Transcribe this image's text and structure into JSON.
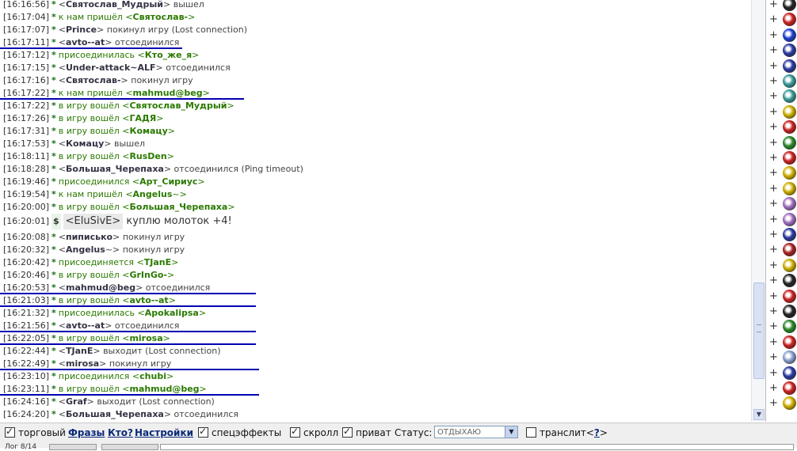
{
  "chat": {
    "lines": [
      {
        "ts": "[16:16:56]",
        "marker": "*",
        "segments": [
          {
            "t": "<",
            "c": "gray"
          },
          {
            "t": "Святослав_Мудрый",
            "c": "nick dark"
          },
          {
            "t": ">",
            "c": "gray"
          },
          {
            "t": " вышел",
            "c": "gray"
          }
        ]
      },
      {
        "ts": "[16:17:04]",
        "marker": "*",
        "segments": [
          {
            "t": "к нам пришёл <",
            "c": "green"
          },
          {
            "t": "Святослав-",
            "c": "nick green"
          },
          {
            "t": ">",
            "c": "green"
          }
        ]
      },
      {
        "ts": "[16:17:07]",
        "marker": "*",
        "segments": [
          {
            "t": "<",
            "c": "gray"
          },
          {
            "t": "Prince",
            "c": "nick dark"
          },
          {
            "t": "> покинул игру (Lost connection)",
            "c": "gray"
          }
        ]
      },
      {
        "ts": "[16:17:11]",
        "marker": "*",
        "segments": [
          {
            "t": "<",
            "c": "gray"
          },
          {
            "t": "avto--at",
            "c": "nick dark"
          },
          {
            "t": "> отсоединился",
            "c": "gray"
          }
        ],
        "ul": 230
      },
      {
        "ts": "[16:17:12]",
        "marker": "*",
        "segments": [
          {
            "t": "присоединилась <",
            "c": "green"
          },
          {
            "t": "Кто_же_я",
            "c": "nick green"
          },
          {
            "t": ">",
            "c": "green"
          }
        ]
      },
      {
        "ts": "[16:17:15]",
        "marker": "*",
        "segments": [
          {
            "t": "<",
            "c": "gray"
          },
          {
            "t": "Under-attack~ALF",
            "c": "nick dark"
          },
          {
            "t": "> отсоединился",
            "c": "gray"
          }
        ]
      },
      {
        "ts": "[16:17:16]",
        "marker": "*",
        "segments": [
          {
            "t": "<",
            "c": "gray"
          },
          {
            "t": "Святослав-",
            "c": "nick dark"
          },
          {
            "t": "> покинул игру",
            "c": "gray"
          }
        ]
      },
      {
        "ts": "[16:17:22]",
        "marker": "*",
        "segments": [
          {
            "t": "к нам пришёл <",
            "c": "green"
          },
          {
            "t": "mahmud@beg",
            "c": "nick green"
          },
          {
            "t": ">",
            "c": "green"
          }
        ],
        "ul": 308
      },
      {
        "ts": "[16:17:22]",
        "marker": "*",
        "segments": [
          {
            "t": "в игру вошёл <",
            "c": "green"
          },
          {
            "t": "Святослав_Мудрый",
            "c": "nick green"
          },
          {
            "t": ">",
            "c": "green"
          }
        ]
      },
      {
        "ts": "[16:17:26]",
        "marker": "*",
        "segments": [
          {
            "t": "в игру вошёл <",
            "c": "green"
          },
          {
            "t": "ГАДЯ",
            "c": "nick green"
          },
          {
            "t": ">",
            "c": "green"
          }
        ]
      },
      {
        "ts": "[16:17:31]",
        "marker": "*",
        "segments": [
          {
            "t": "в игру вошёл <",
            "c": "green"
          },
          {
            "t": "Комацу",
            "c": "nick green"
          },
          {
            "t": ">",
            "c": "green"
          }
        ]
      },
      {
        "ts": "[16:17:53]",
        "marker": "*",
        "segments": [
          {
            "t": "<",
            "c": "gray"
          },
          {
            "t": "Комацу",
            "c": "nick dark"
          },
          {
            "t": "> вышел",
            "c": "gray"
          }
        ]
      },
      {
        "ts": "[16:18:11]",
        "marker": "*",
        "segments": [
          {
            "t": "в игру вошёл <",
            "c": "green"
          },
          {
            "t": "RusDen",
            "c": "nick green"
          },
          {
            "t": ">",
            "c": "green"
          }
        ]
      },
      {
        "ts": "[16:18:28]",
        "marker": "*",
        "segments": [
          {
            "t": "<",
            "c": "gray"
          },
          {
            "t": "Большая_Черепаха",
            "c": "nick dark"
          },
          {
            "t": "> отсоединился (Ping timeout)",
            "c": "gray"
          }
        ]
      },
      {
        "ts": "[16:19:46]",
        "marker": "*",
        "segments": [
          {
            "t": "присоединился <",
            "c": "green"
          },
          {
            "t": "Арт_Сириус",
            "c": "nick green"
          },
          {
            "t": ">",
            "c": "green"
          }
        ]
      },
      {
        "ts": "[16:19:54]",
        "marker": "*",
        "segments": [
          {
            "t": "к нам пришёл <",
            "c": "green"
          },
          {
            "t": "Angelus",
            "c": "nick green"
          },
          {
            "t": "~>",
            "c": "green"
          }
        ]
      },
      {
        "ts": "[16:20:00]",
        "marker": "*",
        "segments": [
          {
            "t": "в игру вошёл <",
            "c": "green"
          },
          {
            "t": "Большая_Черепаха",
            "c": "nick green"
          },
          {
            "t": ">",
            "c": "green"
          }
        ]
      },
      {
        "ts": "[16:20:01]",
        "marker": "$",
        "big": true,
        "segments": [
          {
            "t": "<EluSivE>",
            "c": "bigbox"
          },
          {
            "t": " куплю молоток +4!",
            "c": "big"
          }
        ]
      },
      {
        "ts": "[16:20:08]",
        "marker": "*",
        "segments": [
          {
            "t": "<",
            "c": "gray"
          },
          {
            "t": "пиписько",
            "c": "nick dark"
          },
          {
            "t": "> покинул игру",
            "c": "gray"
          }
        ]
      },
      {
        "ts": "[16:20:32]",
        "marker": "*",
        "segments": [
          {
            "t": "<",
            "c": "gray"
          },
          {
            "t": "Angelus",
            "c": "nick dark"
          },
          {
            "t": "~> покинул игру",
            "c": "gray"
          }
        ]
      },
      {
        "ts": "[16:20:42]",
        "marker": "*",
        "segments": [
          {
            "t": "присоединяется <",
            "c": "green"
          },
          {
            "t": "TJanE",
            "c": "nick green"
          },
          {
            "t": ">",
            "c": "green"
          }
        ]
      },
      {
        "ts": "[16:20:46]",
        "marker": "*",
        "segments": [
          {
            "t": "в игру вошёл <",
            "c": "green"
          },
          {
            "t": "GrInGo-",
            "c": "nick green"
          },
          {
            "t": ">",
            "c": "green"
          }
        ]
      },
      {
        "ts": "[16:20:53]",
        "marker": "*",
        "segments": [
          {
            "t": "<",
            "c": "gray"
          },
          {
            "t": "mahmud@beg",
            "c": "nick dark"
          },
          {
            "t": "> отсоединился",
            "c": "gray"
          }
        ],
        "ul": 323
      },
      {
        "ts": "[16:21:03]",
        "marker": "*",
        "segments": [
          {
            "t": "в игру вошёл <",
            "c": "green"
          },
          {
            "t": "avto--at",
            "c": "nick green"
          },
          {
            "t": ">",
            "c": "green"
          }
        ],
        "ul": 323
      },
      {
        "ts": "[16:21:32]",
        "marker": "*",
        "segments": [
          {
            "t": "присоединилась <",
            "c": "green"
          },
          {
            "t": "Apokalipsa",
            "c": "nick green"
          },
          {
            "t": ">",
            "c": "green"
          }
        ]
      },
      {
        "ts": "[16:21:56]",
        "marker": "*",
        "segments": [
          {
            "t": "<",
            "c": "gray"
          },
          {
            "t": "avto--at",
            "c": "nick dark"
          },
          {
            "t": "> отсоединился",
            "c": "gray"
          }
        ],
        "ul": 323
      },
      {
        "ts": "[16:22:05]",
        "marker": "*",
        "segments": [
          {
            "t": "в игру вошёл <",
            "c": "green"
          },
          {
            "t": "mirosa",
            "c": "nick green"
          },
          {
            "t": ">",
            "c": "green"
          }
        ],
        "ul": 323
      },
      {
        "ts": "[16:22:44]",
        "marker": "*",
        "segments": [
          {
            "t": "<",
            "c": "gray"
          },
          {
            "t": "TJanE",
            "c": "nick dark"
          },
          {
            "t": "> выходит (Lost connection)",
            "c": "gray"
          }
        ]
      },
      {
        "ts": "[16:22:49]",
        "marker": "*",
        "segments": [
          {
            "t": "<",
            "c": "gray"
          },
          {
            "t": "mirosa",
            "c": "nick dark"
          },
          {
            "t": "> покинул игру",
            "c": "gray"
          }
        ],
        "ul": 327
      },
      {
        "ts": "[16:23:10]",
        "marker": "*",
        "segments": [
          {
            "t": "присоединился <",
            "c": "green"
          },
          {
            "t": "chubi",
            "c": "nick green"
          },
          {
            "t": ">",
            "c": "green"
          }
        ]
      },
      {
        "ts": "[16:23:11]",
        "marker": "*",
        "segments": [
          {
            "t": "в игру вошёл <",
            "c": "green"
          },
          {
            "t": "mahmud@beg",
            "c": "nick green"
          },
          {
            "t": ">",
            "c": "green"
          }
        ],
        "ul": 327
      },
      {
        "ts": "[16:24:16]",
        "marker": "*",
        "segments": [
          {
            "t": "<",
            "c": "gray"
          },
          {
            "t": "Graf",
            "c": "nick dark"
          },
          {
            "t": "> выходит (Lost connection)",
            "c": "gray"
          }
        ]
      },
      {
        "ts": "[16:24:20]",
        "marker": "*",
        "segments": [
          {
            "t": "<",
            "c": "gray"
          },
          {
            "t": "Большая_Черепаха",
            "c": "nick dark"
          },
          {
            "t": "> отсоединился",
            "c": "gray"
          }
        ]
      }
    ]
  },
  "users": {
    "rows": [
      {
        "plus": "+",
        "icon": "paw-icon",
        "color": "#222222"
      },
      {
        "plus": "+",
        "icon": "red-swirl-icon",
        "color": "#cc2222"
      },
      {
        "plus": "+",
        "icon": "blue-h-icon",
        "color": "#1a3fd0"
      },
      {
        "plus": "+",
        "icon": "blue-wings-icon",
        "color": "#2a3aa0"
      },
      {
        "plus": "+",
        "icon": "blue-wings-icon",
        "color": "#2a3aa0"
      },
      {
        "plus": "+",
        "icon": "teal-orb-icon",
        "color": "#3a9a9a"
      },
      {
        "plus": "+",
        "icon": "teal-orb-icon",
        "color": "#3a9a9a"
      },
      {
        "plus": "+",
        "icon": "yellow-leaf-icon",
        "color": "#d0b000"
      },
      {
        "plus": "+",
        "icon": "red-swirl-icon",
        "color": "#cc2222"
      },
      {
        "plus": "+",
        "icon": "green-globe-icon",
        "color": "#2a8a2a"
      },
      {
        "plus": "+",
        "icon": "red-swirl-icon",
        "color": "#cc2222"
      },
      {
        "plus": "+",
        "icon": "yellow-leaf-icon",
        "color": "#d0b000"
      },
      {
        "plus": "+",
        "icon": "yellow-leaf-icon",
        "color": "#d0b000"
      },
      {
        "plus": "+",
        "icon": "purple-wings-icon",
        "color": "#a070c0"
      },
      {
        "plus": "+",
        "icon": "purple-wings-icon",
        "color": "#a070c0"
      },
      {
        "plus": "+",
        "icon": "blue-wings-icon",
        "color": "#2a3aa0"
      },
      {
        "plus": "+",
        "icon": "red-cross-icon",
        "color": "#aa2222"
      },
      {
        "plus": "+",
        "icon": "yellow-leaf-icon",
        "color": "#d0b000"
      },
      {
        "plus": "+",
        "icon": "paw-icon",
        "color": "#222222"
      },
      {
        "plus": "+",
        "icon": "red-swirl-icon",
        "color": "#cc2222"
      },
      {
        "plus": "+",
        "icon": "red-black-wedge-icon",
        "color": "#222222"
      },
      {
        "plus": "+",
        "icon": "green-globe-icon",
        "color": "#2a8a2a"
      },
      {
        "plus": "+",
        "icon": "red-swirl-icon",
        "color": "#cc2222"
      },
      {
        "plus": "+",
        "icon": "purple-wings-icon",
        "color": "#8aa0d0"
      },
      {
        "plus": "+",
        "icon": "blue-wings-icon",
        "color": "#2a3aa0"
      },
      {
        "plus": "+",
        "icon": "red-swirl-icon",
        "color": "#cc2222"
      },
      {
        "plus": "+",
        "icon": "yellow-leaf-icon",
        "color": "#d0b000"
      }
    ]
  },
  "toolbar": {
    "trade_label": "торговый",
    "phrases_link": "Фразы",
    "who_link": "Кто?",
    "settings_link": "Настройки",
    "effects_label": "спецэффекты",
    "scroll_label": "скролл",
    "private_label": "приват",
    "status_label": "Статус:",
    "status_value": "ОТДЫХАЮ",
    "translit_label": "транслит<",
    "translit_help": "?",
    "translit_close": ">",
    "page_indicator": "Лог 8/14"
  },
  "colors": {
    "underline": "#0000b0",
    "green": "#2a7a00",
    "link": "#0a2a7a"
  }
}
